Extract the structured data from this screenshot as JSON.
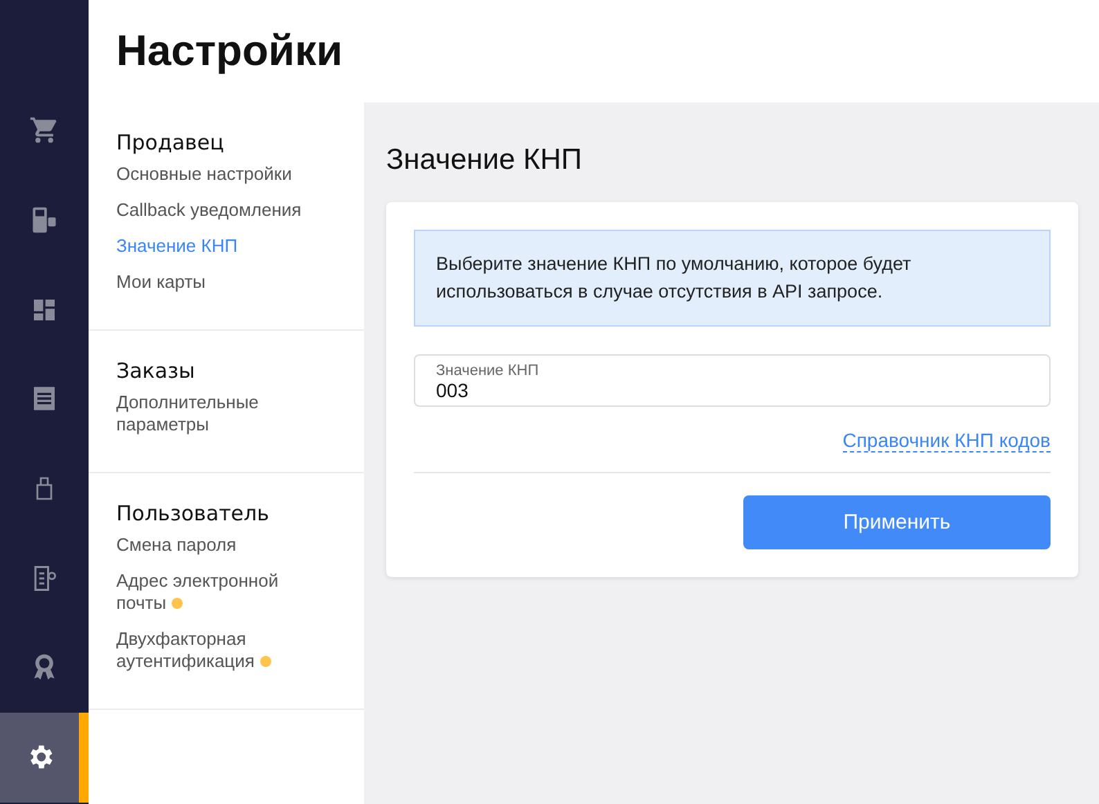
{
  "rail": [
    {
      "kind": "cart",
      "selected": false
    },
    {
      "kind": "terminal",
      "selected": false
    },
    {
      "kind": "dashboard",
      "selected": false
    },
    {
      "kind": "receipt",
      "selected": false
    },
    {
      "kind": "pos",
      "selected": false
    },
    {
      "kind": "document",
      "selected": false
    },
    {
      "kind": "award",
      "selected": false
    },
    {
      "kind": "settings",
      "selected": true
    }
  ],
  "header": {
    "title": "Настройки"
  },
  "nav": [
    {
      "heading": "Продавец",
      "items": [
        {
          "label": "Основные настройки",
          "selected": false,
          "dot": false
        },
        {
          "label": "Callback уведомления",
          "selected": false,
          "dot": false
        },
        {
          "label": "Значение КНП",
          "selected": true,
          "dot": false
        },
        {
          "label": "Мои карты",
          "selected": false,
          "dot": false
        }
      ]
    },
    {
      "heading": "Заказы",
      "items": [
        {
          "label": "Дополнительные параметры",
          "selected": false,
          "dot": false
        }
      ]
    },
    {
      "heading": "Пользователь",
      "items": [
        {
          "label": "Смена пароля",
          "selected": false,
          "dot": false
        },
        {
          "label": "Адрес электронной почты",
          "selected": false,
          "dot": true
        },
        {
          "label": "Двухфакторная аутентификация",
          "selected": false,
          "dot": true
        }
      ]
    }
  ],
  "page": {
    "title": "Значение КНП",
    "info": "Выберите значение КНП по умолчанию, которое будет использоваться в случае отсутствия в API запросе.",
    "field": {
      "label": "Значение КНП",
      "value": "003"
    },
    "link": "Справочник КНП кодов",
    "button": "Применить"
  }
}
